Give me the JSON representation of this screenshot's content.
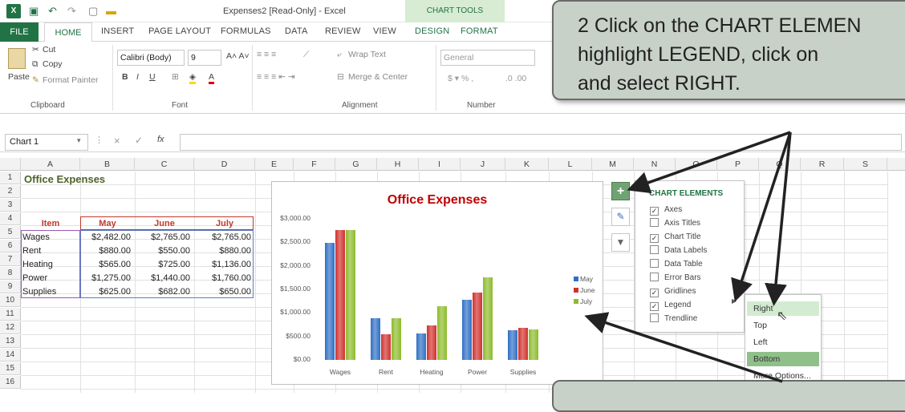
{
  "app": {
    "doc_title": "Expenses2 [Read-Only] - Excel",
    "chart_tools": "CHART TOOLS"
  },
  "tabs": [
    "FILE",
    "HOME",
    "INSERT",
    "PAGE LAYOUT",
    "FORMULAS",
    "DATA",
    "REVIEW",
    "VIEW",
    "DESIGN",
    "FORMAT"
  ],
  "ribbon": {
    "clipboard": {
      "paste": "Paste",
      "cut": "Cut",
      "copy": "Copy",
      "format_painter": "Format Painter",
      "label": "Clipboard"
    },
    "font": {
      "name": "Calibri (Body)",
      "size": "9",
      "label": "Font"
    },
    "alignment": {
      "wrap": "Wrap Text",
      "merge": "Merge & Center",
      "label": "Alignment"
    },
    "number": {
      "format": "General",
      "label": "Number"
    }
  },
  "formula_bar": {
    "name_box": "Chart 1",
    "fx": "fx"
  },
  "columns": [
    "A",
    "B",
    "C",
    "D",
    "E",
    "F",
    "G",
    "H",
    "I",
    "J",
    "K",
    "L",
    "M",
    "N",
    "O",
    "P",
    "Q",
    "R",
    "S"
  ],
  "rows": [
    "1",
    "2",
    "3",
    "4",
    "5",
    "6",
    "7",
    "8",
    "9",
    "10",
    "11",
    "12",
    "13",
    "14",
    "15",
    "16"
  ],
  "sheet": {
    "title": "Office Expenses",
    "headers": [
      "Item",
      "May",
      "June",
      "July"
    ],
    "rows": [
      [
        "Wages",
        "$2,482.00",
        "$2,765.00",
        "$2,765.00"
      ],
      [
        "Rent",
        "$880.00",
        "$550.00",
        "$880.00"
      ],
      [
        "Heating",
        "$565.00",
        "$725.00",
        "$1,136.00"
      ],
      [
        "Power",
        "$1,275.00",
        "$1,440.00",
        "$1,760.00"
      ],
      [
        "Supplies",
        "$625.00",
        "$682.00",
        "$650.00"
      ]
    ]
  },
  "chart_data": {
    "type": "bar",
    "title": "Office Expenses",
    "categories": [
      "Wages",
      "Rent",
      "Heating",
      "Power",
      "Supplies"
    ],
    "series": [
      {
        "name": "May",
        "values": [
          2482,
          880,
          565,
          1275,
          625
        ],
        "color": "#2e6fc4"
      },
      {
        "name": "June",
        "values": [
          2765,
          550,
          725,
          1440,
          682
        ],
        "color": "#d0312d"
      },
      {
        "name": "July",
        "values": [
          2765,
          880,
          1136,
          1760,
          650
        ],
        "color": "#8dbb2c"
      }
    ],
    "y_ticks": [
      "$3,000.00",
      "$2,500.00",
      "$2,000.00",
      "$1,500.00",
      "$1,000.00",
      "$500.00",
      "$0.00"
    ],
    "ylim": [
      0,
      3000
    ],
    "legend_position": "right",
    "grid": false
  },
  "chart_elements": {
    "title": "CHART ELEMENTS",
    "items": [
      {
        "label": "Axes",
        "checked": true
      },
      {
        "label": "Axis Titles",
        "checked": false
      },
      {
        "label": "Chart Title",
        "checked": true
      },
      {
        "label": "Data Labels",
        "checked": false
      },
      {
        "label": "Data Table",
        "checked": false
      },
      {
        "label": "Error Bars",
        "checked": false
      },
      {
        "label": "Gridlines",
        "checked": true
      },
      {
        "label": "Legend",
        "checked": true
      },
      {
        "label": "Trendline",
        "checked": false
      }
    ]
  },
  "legend_submenu": [
    "Right",
    "Top",
    "Left",
    "Bottom",
    "More Options..."
  ],
  "callout": {
    "text_line1": "2  Click on the CHART ELEMEN",
    "text_line2": "highlight LEGEND, click on",
    "text_line3": "and select RIGHT."
  },
  "colors": {
    "excel_green": "#217346",
    "title_red": "#c00000",
    "item_green": "#4f6228"
  }
}
